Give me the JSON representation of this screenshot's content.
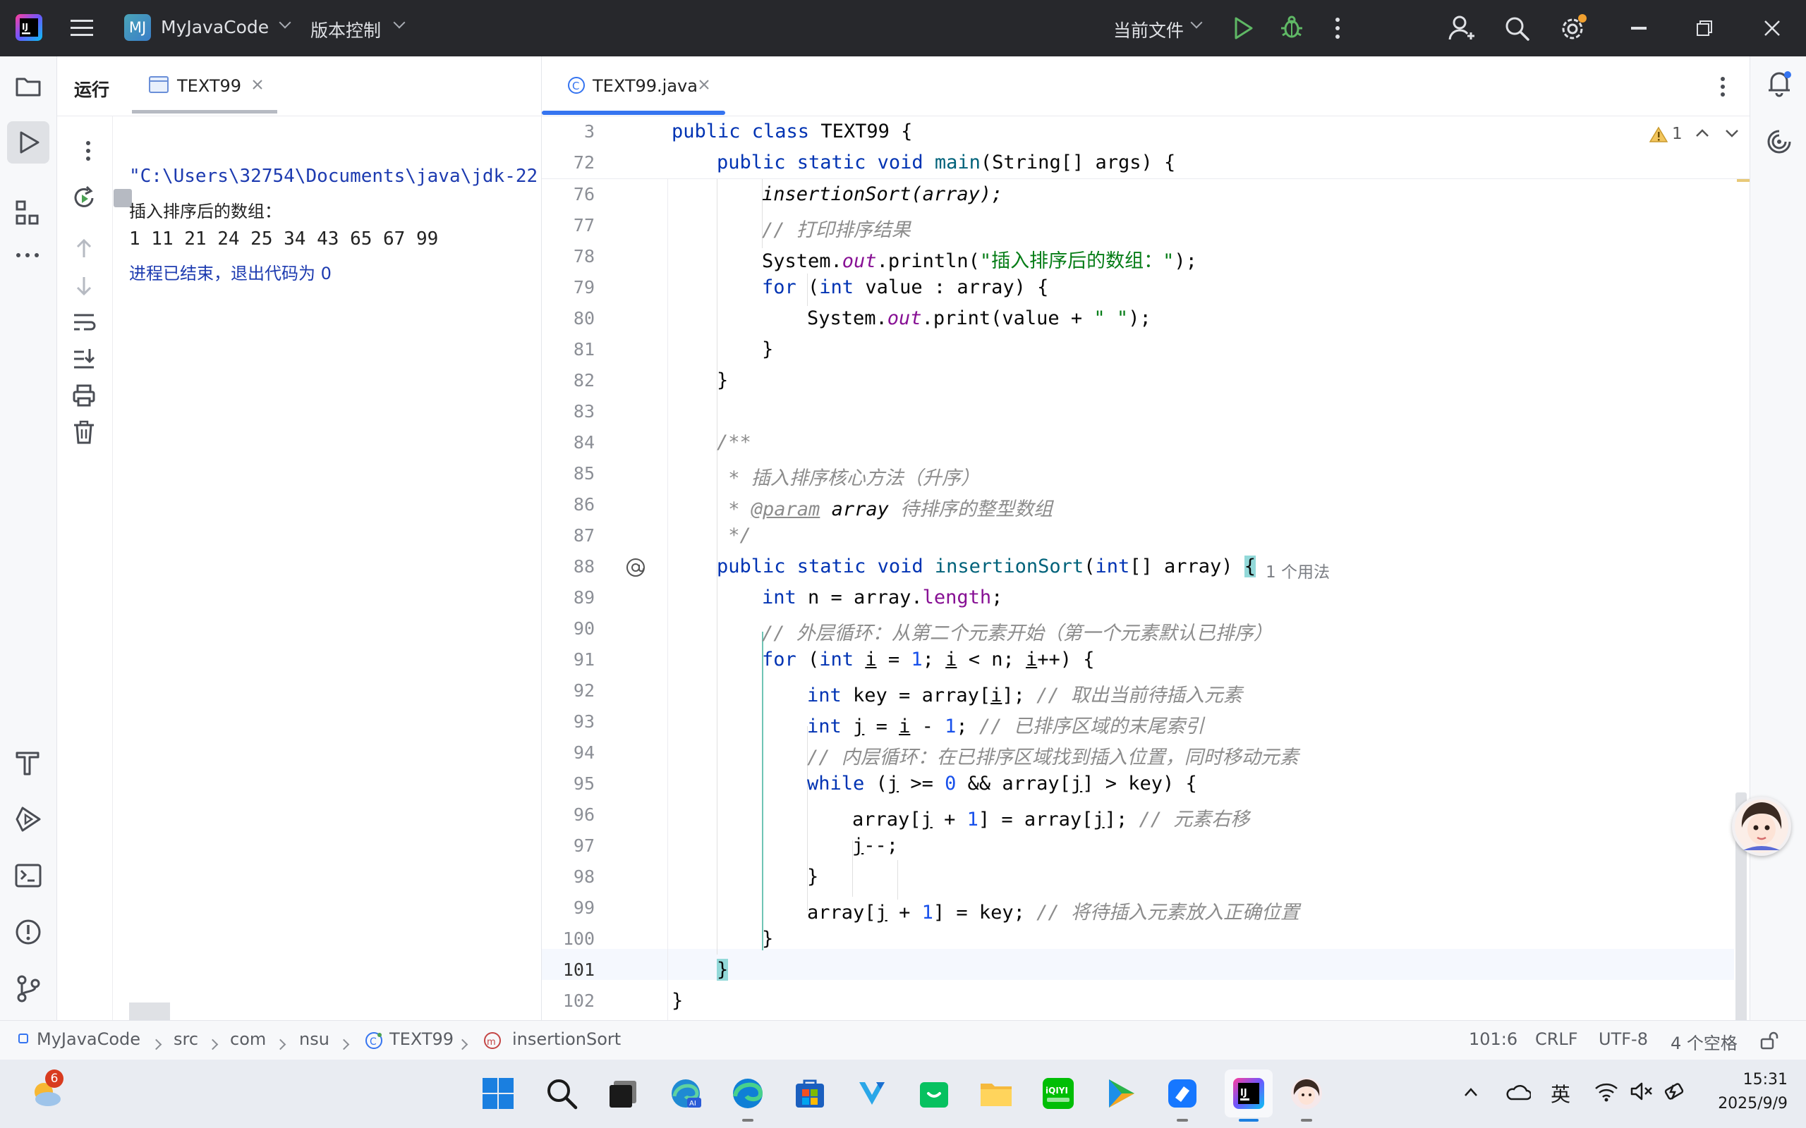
{
  "titlebar": {
    "project_badge": "MJ",
    "project_name": "MyJavaCode",
    "vcs_label": "版本控制",
    "run_config": "当前文件",
    "window_controls": [
      "minimize-icon",
      "restore-icon",
      "close-icon"
    ]
  },
  "run_panel": {
    "title": "运行",
    "tab_label": "TEXT99",
    "console": [
      "\"C:\\Users\\32754\\Documents\\java\\jdk-22",
      "插入排序后的数组：",
      "1 11 21 24 25 34 43 65 67 99",
      "进程已结束，退出代码为 0"
    ]
  },
  "editor": {
    "tab_label": "TEXT99.java",
    "warning_count": "1",
    "usage_hint": "1 个用法",
    "sticky_lines": [
      {
        "ln": "3",
        "code": "public class TEXT99 {"
      },
      {
        "ln": "72",
        "code": "    public static void main(String[] args) {"
      }
    ],
    "line_numbers": [
      "76",
      "77",
      "78",
      "79",
      "80",
      "81",
      "82",
      "83",
      "84",
      "85",
      "86",
      "87",
      "88",
      "89",
      "90",
      "91",
      "92",
      "93",
      "94",
      "95",
      "96",
      "97",
      "98",
      "99",
      "100",
      "101",
      "102"
    ],
    "code_lines": {
      "l76": "insertionSort(array);",
      "l77": "// 打印排序结果",
      "l78_a": "System.",
      "l78_b": "out",
      "l78_c": ".println(",
      "l78_d": "\"插入排序后的数组：\"",
      "l78_e": ");",
      "l79_a": "for",
      "l79_b": " (",
      "l79_c": "int",
      "l79_d": " value : array) {",
      "l80_a": "System.",
      "l80_b": "out",
      "l80_c": ".print(value + ",
      "l80_d": "\" \"",
      "l80_e": ");",
      "l81": "}",
      "l82": "}",
      "l84": "/**",
      "l85": " * 插入排序核心方法（升序）",
      "l86_a": " * ",
      "l86_b": "@param",
      "l86_c": " array",
      "l86_d": " 待排序的整型数组",
      "l87": " */",
      "l88_a": "public static void ",
      "l88_b": "insertionSort",
      "l88_c": "(",
      "l88_d": "int",
      "l88_e": "[] array) ",
      "l88_f": "{",
      "l89_a": "int",
      "l89_b": " n = array.",
      "l89_c": "length",
      "l89_d": ";",
      "l90": "// 外层循环：从第二个元素开始（第一个元素默认已排序）",
      "l91_a": "for",
      "l91_b": " (",
      "l91_c": "int",
      "l91_d": " ",
      "l91_e": "i",
      "l91_f": " = ",
      "l91_g": "1",
      "l91_h": "; ",
      "l91_i": "i",
      "l91_j": " < n; ",
      "l91_k": "i",
      "l91_l": "++) {",
      "l92_a": "int",
      "l92_b": " key = array[",
      "l92_c": "i",
      "l92_d": "]; ",
      "l92_e": "// 取出当前待插入元素",
      "l93_a": "int",
      "l93_b": " ",
      "l93_c": "j",
      "l93_d": " = ",
      "l93_e": "i",
      "l93_f": " - ",
      "l93_g": "1",
      "l93_h": "; ",
      "l93_i": "// 已排序区域的末尾索引",
      "l94": "// 内层循环：在已排序区域找到插入位置，同时移动元素",
      "l95_a": "while",
      "l95_b": " (",
      "l95_c": "j",
      "l95_d": " >= ",
      "l95_e": "0",
      "l95_f": " && array[",
      "l95_g": "j",
      "l95_h": "] > key) {",
      "l96_a": "array[",
      "l96_b": "j",
      "l96_c": " + ",
      "l96_d": "1",
      "l96_e": "] = array[",
      "l96_f": "j",
      "l96_g": "]; ",
      "l96_h": "// 元素右移",
      "l97_a": "j",
      "l97_b": "--;",
      "l98": "}",
      "l99_a": "array[",
      "l99_b": "j",
      "l99_c": " + ",
      "l99_d": "1",
      "l99_e": "] = key; ",
      "l99_f": "// 将待插入元素放入正确位置",
      "l100": "}",
      "l101": "}",
      "l102": "}"
    }
  },
  "statusbar": {
    "breadcrumbs": [
      "MyJavaCode",
      "src",
      "com",
      "nsu",
      "TEXT99",
      "insertionSort"
    ],
    "position": "101:6",
    "line_separator": "CRLF",
    "encoding": "UTF-8",
    "indent": "4 个空格"
  },
  "taskbar": {
    "weather_badge": "6",
    "ime_label": "英",
    "time": "15:31",
    "date": "2025/9/9",
    "app_icons": [
      "start-icon",
      "search-icon",
      "taskview-icon",
      "edge-ai-icon",
      "edge-icon",
      "store-icon",
      "vscode-icon",
      "wechat-icon",
      "explorer-icon",
      "iqiyi-icon",
      "video-player-icon",
      "messenger-icon",
      "intellij-icon",
      "avatar-app-icon"
    ]
  },
  "colors": {
    "titlebar_bg": "#27282c",
    "keyword": "#0033b3",
    "string": "#067d17",
    "comment": "#8c8c8c",
    "number": "#1750eb",
    "field": "#871094",
    "run_green": "#4ca154",
    "tab_accent": "#3574f0"
  }
}
